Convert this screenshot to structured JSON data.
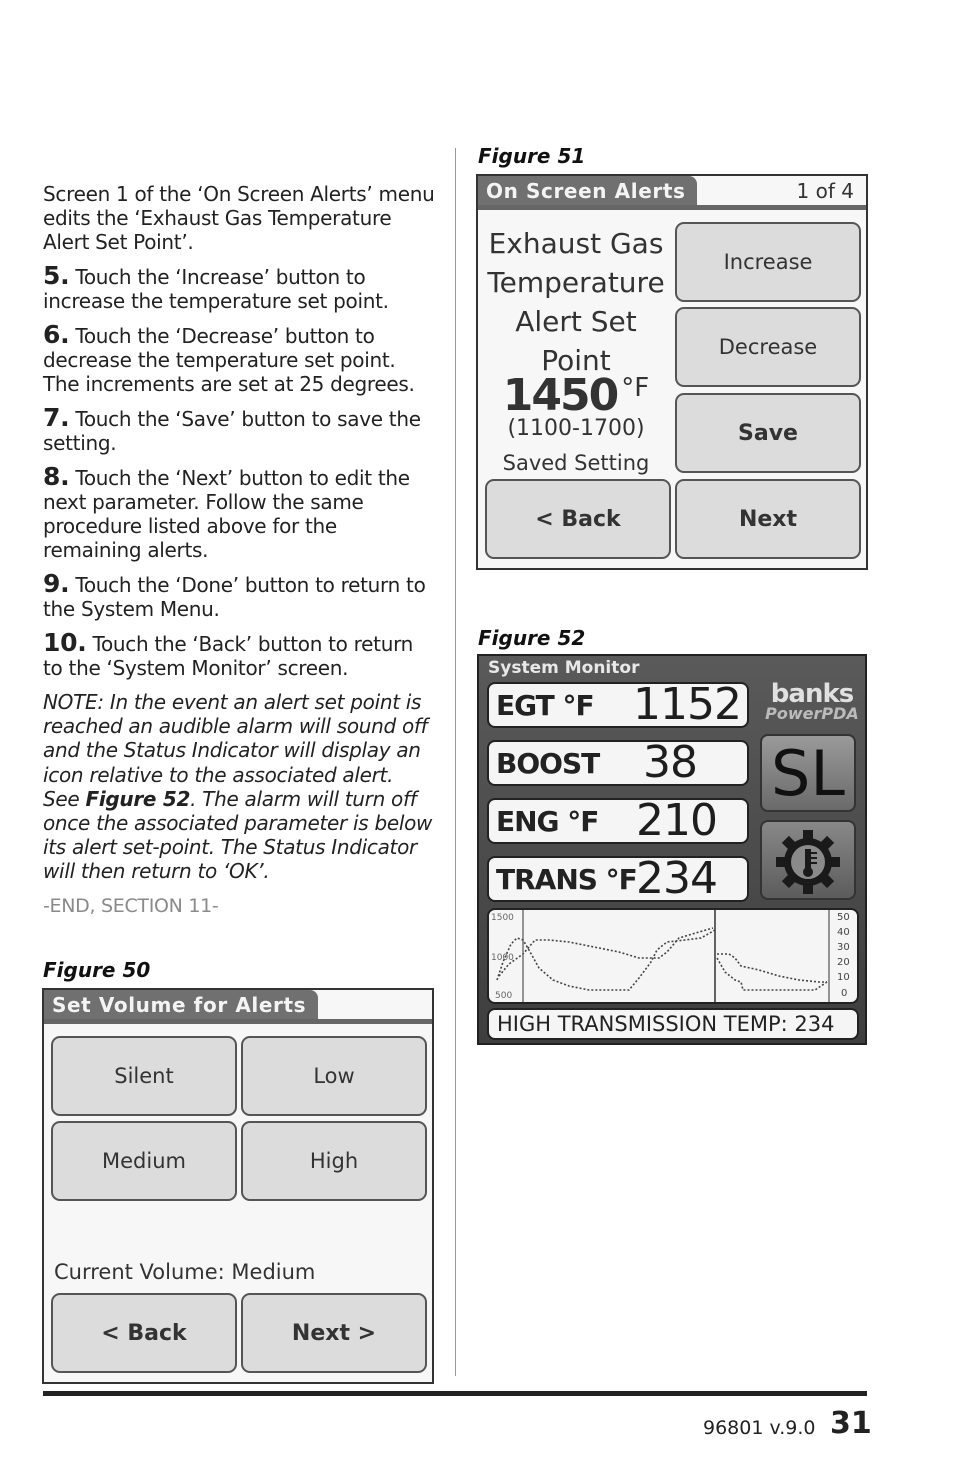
{
  "left_column": {
    "intro": "Screen 1 of the ‘On Screen Alerts’ menu edits the ‘Exhaust Gas Temperature Alert Set Point’.",
    "steps": [
      {
        "num": "5.",
        "text": " Touch the ‘Increase’ button to increase the temperature set point."
      },
      {
        "num": "6.",
        "text": " Touch the ‘Decrease’ button to decrease the temperature set point. The increments are set at 25 degrees."
      },
      {
        "num": "7.",
        "text": " Touch the ‘Save’ button to save the setting."
      },
      {
        "num": "8.",
        "text": " Touch the ‘Next’ button to edit the next parameter. Follow the same procedure listed above for the remaining alerts."
      },
      {
        "num": "9.",
        "text": " Touch the ‘Done’ button to return to the System Menu."
      },
      {
        "num": "10.",
        "text": " Touch the ‘Back’ button to return to the ‘System Monitor’ screen."
      }
    ],
    "note_before": "NOTE: In the event an alert set point is reached an audible alarm will sound off and the Status Indicator will display an icon relative to the associated alert. See ",
    "note_ref": "Figure 52",
    "note_after": ". The alarm will turn off once the associated parameter is below its alert set-point. The Status Indicator will then return to ‘OK’.",
    "end_marker": "-END, SECTION 11-"
  },
  "figure50": {
    "label": "Figure 50",
    "tab_title": "Set Volume for Alerts",
    "buttons": [
      "Silent",
      "Low",
      "Medium",
      "High"
    ],
    "current_volume_label": "Current Volume:",
    "current_volume_value": "Medium",
    "back_label": "< Back",
    "next_label": "Next >"
  },
  "figure51": {
    "label": "Figure 51",
    "tab_title": "On Screen Alerts",
    "page_indicator": "1 of 4",
    "param_lines": [
      "Exhaust Gas",
      "Temperature",
      "Alert Set Point"
    ],
    "value": "1450",
    "unit": "°F",
    "range": "(1100-1700)",
    "status": "Saved Setting",
    "increase_label": "Increase",
    "decrease_label": "Decrease",
    "save_label": "Save",
    "back_label": "< Back",
    "next_label": "Next"
  },
  "figure52": {
    "label": "Figure 52",
    "title": "System Monitor",
    "gauges": [
      {
        "label": "EGT °F",
        "value": "1152"
      },
      {
        "label": "BOOST",
        "value": "38"
      },
      {
        "label": "ENG °F",
        "value": "210"
      },
      {
        "label": "TRANS °F",
        "value": "234"
      }
    ],
    "logo_top": "banks",
    "logo_bottom": "PowerPDA",
    "status_indicator": "SL",
    "gear_icon": "transmission-temp-icon",
    "graph": {
      "left_axis_ticks": [
        "1500",
        "1000",
        "500"
      ],
      "right_axis_ticks": [
        "50",
        "40",
        "30",
        "20",
        "10",
        "0"
      ]
    },
    "alert_message": "HIGH TRANSMISSION TEMP: 234"
  },
  "footer": {
    "doc_id": "96801 v.9.0",
    "page_number": "31"
  }
}
